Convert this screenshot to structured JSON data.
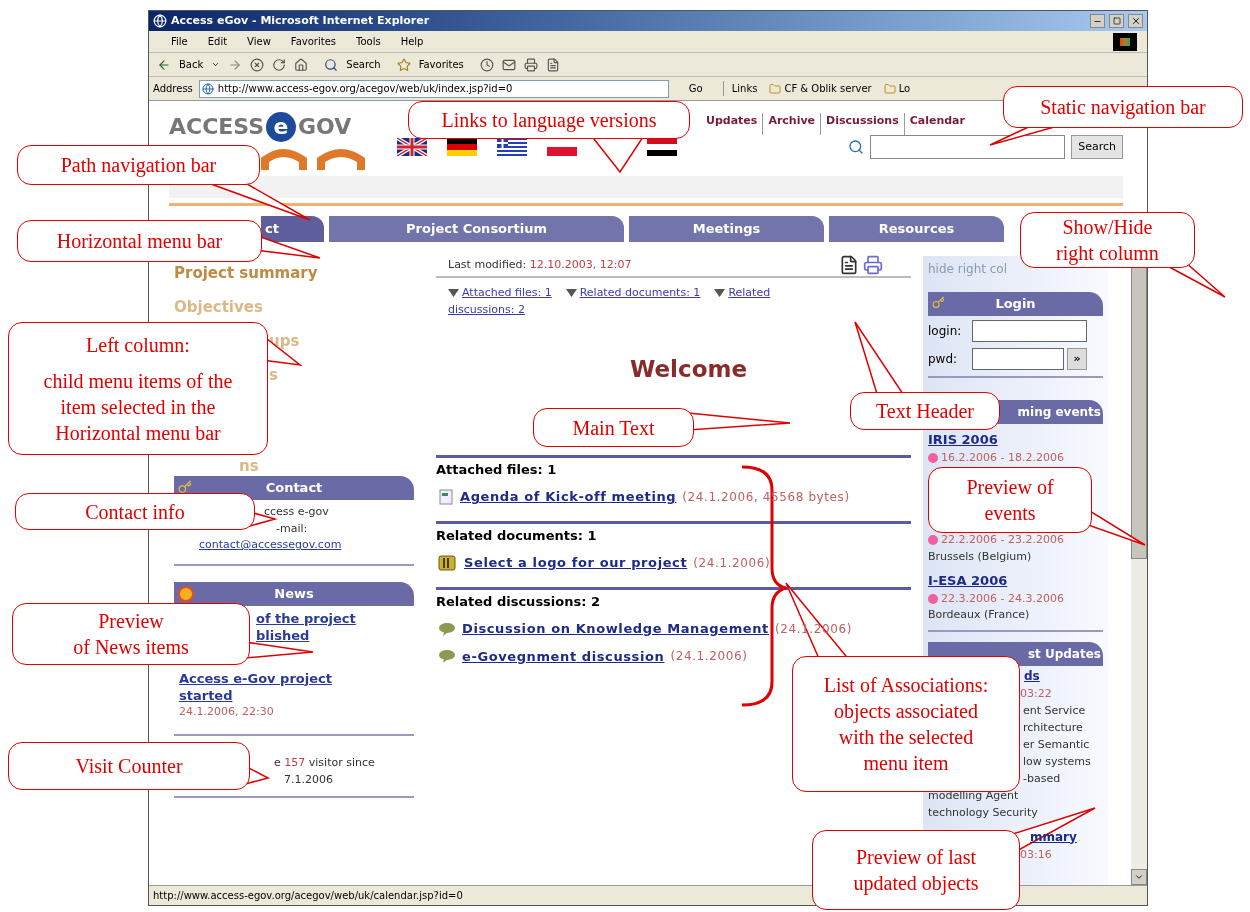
{
  "window": {
    "title": "Access eGov - Microsoft Internet Explorer"
  },
  "menu_bar": [
    "File",
    "Edit",
    "View",
    "Favorites",
    "Tools",
    "Help"
  ],
  "toolbar": {
    "back": "Back",
    "search": "Search",
    "favorites": "Favorites"
  },
  "address_bar": {
    "label": "Address",
    "url": "http://www.access-egov.org/acegov/web/uk/index.jsp?id=0",
    "go": "Go"
  },
  "links_bar": {
    "label": "Links",
    "items": [
      "CF & Oblik server",
      "Lo"
    ]
  },
  "site": {
    "logo": {
      "left": "ACCESS",
      "middle": "e",
      "right": "GOV"
    },
    "static_nav": [
      "Updates",
      "Archive",
      "Discussions",
      "Calendar"
    ],
    "flags": [
      {
        "kind": "uk"
      },
      {
        "kind": "de"
      },
      {
        "kind": "gr"
      },
      {
        "kind": "pl"
      },
      {
        "kind": "eg"
      }
    ],
    "search_button": "Search",
    "tabs": [
      {
        "label": "ct",
        "selected": true
      },
      {
        "label": "Project Consortium",
        "selected": false
      },
      {
        "label": "Meetings",
        "selected": false
      },
      {
        "label": "Resources",
        "selected": false
      }
    ],
    "left_menu": [
      {
        "label": "Project summary",
        "selected": true
      },
      {
        "label": "Objectives",
        "selected": false
      },
      {
        "label": "ups",
        "selected": false
      },
      {
        "label": "s",
        "selected": false
      },
      {
        "label": "ns",
        "selected": false
      }
    ],
    "contact": {
      "title": "Contact",
      "lines": [
        "ccess e-gov",
        "-mail:"
      ],
      "email": "contact@accessegov.com"
    },
    "news": {
      "title": "News",
      "items": [
        {
          "lines": [
            "of the project",
            "blished"
          ]
        },
        {
          "lines": [
            "Access e-Gov project",
            "started"
          ],
          "date": "24.1.2006, 22:30"
        }
      ]
    },
    "visits": {
      "before": "e",
      "count": "157",
      "after": "visitor since",
      "date": "7.1.2006"
    },
    "main": {
      "modified_label": "Last modified:",
      "modified": "12.10.2003, 12:07",
      "jump_links": [
        {
          "lines": [
            "Attached files: 1"
          ]
        },
        {
          "lines": [
            "Related documents: 1"
          ]
        },
        {
          "lines": [
            "Related",
            "discussions: 2"
          ]
        }
      ],
      "title": "Welcome",
      "sections": [
        {
          "heading": "Attached files: 1",
          "items": [
            {
              "kind": "file",
              "link": "Agenda of Kick-off meeting",
              "info": "(24.1.2006, 45568 bytes)"
            }
          ]
        },
        {
          "heading": "Related documents: 1",
          "items": [
            {
              "kind": "document",
              "link": "Select a logo for our project",
              "info": "(24.1.2006)"
            }
          ]
        },
        {
          "heading": "Related discussions: 2",
          "items": [
            {
              "kind": "discussion",
              "link": "Discussion on Knowledge Management",
              "info": "(24.1.2006)"
            },
            {
              "kind": "discussion",
              "link": "e-Govegnment discussion",
              "info": "(24.1.2006)"
            }
          ]
        }
      ]
    },
    "right": {
      "hide": "hide right col",
      "login": {
        "title": "Login",
        "login_label": "login:",
        "pwd_label": "pwd:",
        "submit": "»"
      },
      "events": {
        "title": "ming events",
        "items": [
          {
            "name": "IRIS 2006",
            "dates": "16.2.2006 - 18.2.2006"
          },
          {
            "dates": "22.2.2006 - 23.2.2006",
            "place": "Brussels (Belgium)"
          },
          {
            "name": "I-ESA 2006",
            "dates": "22.3.2006 - 24.3.2006",
            "place": "Bordeaux (France)"
          }
        ]
      },
      "updates": {
        "title": "st Updates",
        "items": [
          {
            "name": "ds",
            "date": "03:22",
            "text": [
              "ent Service",
              "rchitecture",
              "er Semantic",
              "low systems",
              "-based",
              "modelling Agent",
              "technology Security"
            ]
          },
          {
            "name": "mmary",
            "date": "03:16"
          }
        ]
      }
    }
  },
  "status_bar": "http://www.access-egov.org/acegov/web/uk/calendar.jsp?id=0",
  "annotations": [
    {
      "lines": [
        "Links to language versions"
      ]
    },
    {
      "lines": [
        "Static navigation bar"
      ]
    },
    {
      "lines": [
        "Path navigation bar"
      ]
    },
    {
      "lines": [
        "Horizontal menu bar"
      ]
    },
    {
      "lines": [
        "Show/Hide",
        "right column"
      ]
    },
    {
      "lines": [
        "Left column:",
        "child menu items of the",
        "item selected in the",
        "Horizontal menu bar"
      ]
    },
    {
      "lines": [
        "Text Header"
      ]
    },
    {
      "lines": [
        "Main Text"
      ]
    },
    {
      "lines": [
        "Contact info"
      ]
    },
    {
      "lines": [
        "Preview of",
        "events"
      ]
    },
    {
      "lines": [
        "Preview",
        "of News items"
      ]
    },
    {
      "lines": [
        "Visit Counter"
      ]
    },
    {
      "lines": [
        "List of Associations:",
        "objects associated",
        "with the selected",
        "menu item"
      ]
    },
    {
      "lines": [
        "Preview of last",
        "updated objects"
      ]
    }
  ]
}
